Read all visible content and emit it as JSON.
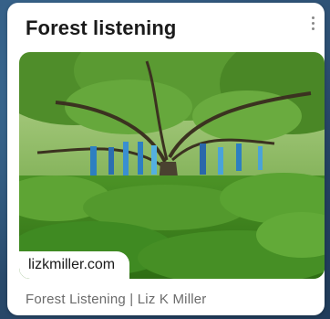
{
  "card": {
    "title": "Forest listening",
    "domain": "lizkmiller.com",
    "caption": "Forest Listening | Liz K Miller"
  },
  "icons": {
    "menu": "more-vertical-icon"
  },
  "colors": {
    "title": "#1a1a1a",
    "caption": "#6b6b6b",
    "foliage": "#3f8a22",
    "panels": "#2d7fc1"
  }
}
